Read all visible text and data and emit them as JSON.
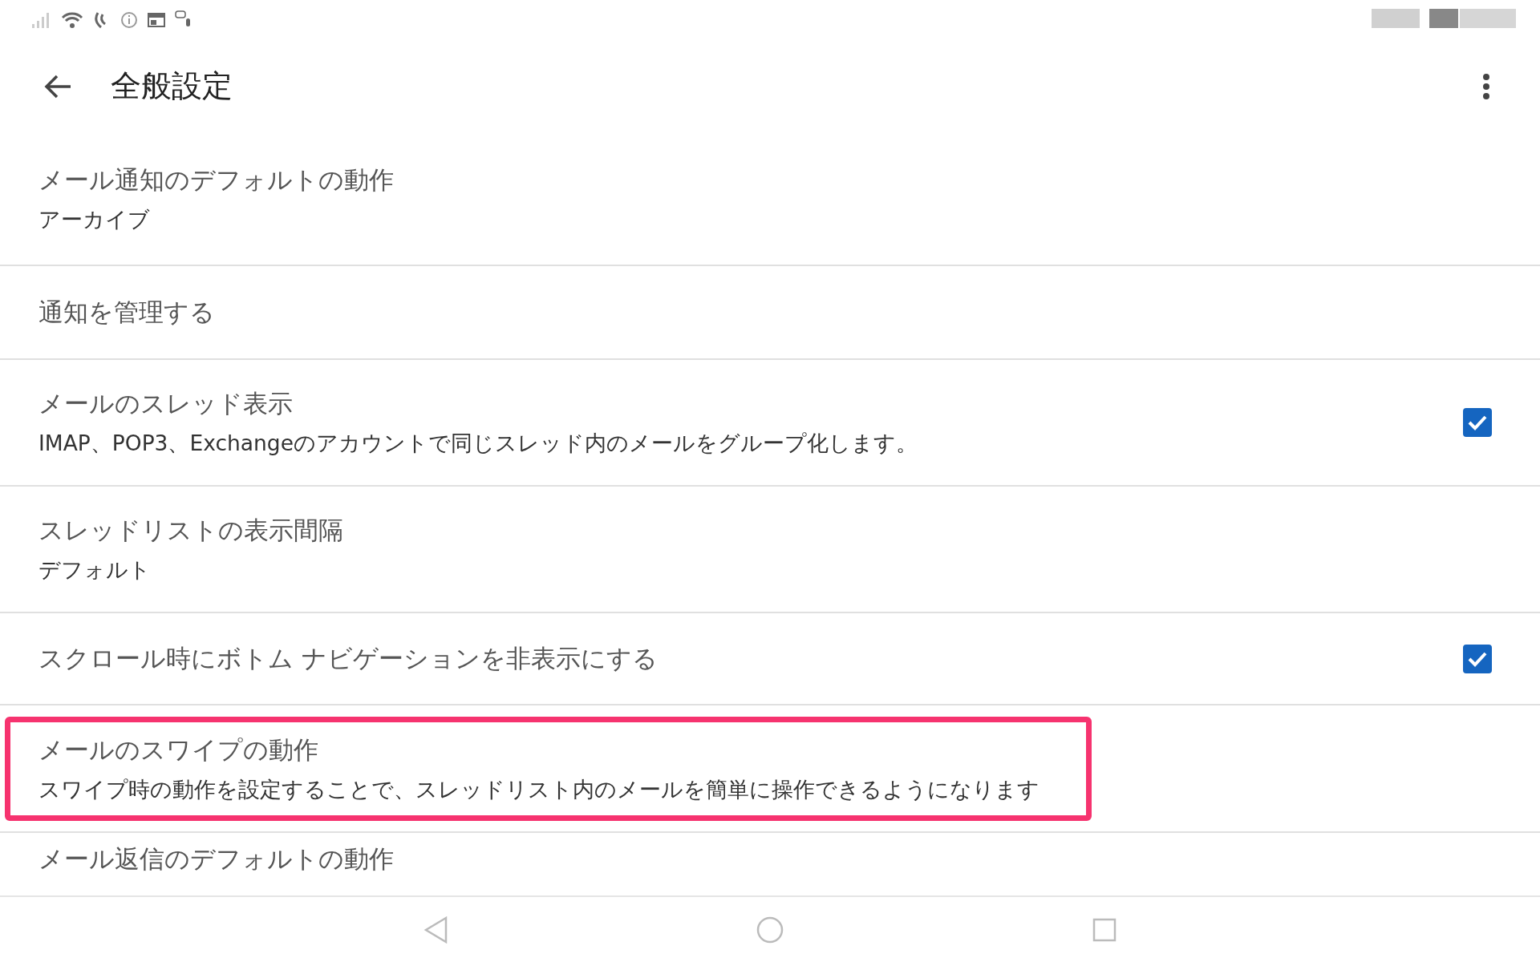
{
  "header": {
    "title": "全般設定"
  },
  "settings": [
    {
      "title": "メール通知のデフォルトの動作",
      "subtitle": "アーカイブ",
      "highlighted": false
    },
    {
      "title": "通知を管理する",
      "highlighted": false
    },
    {
      "title": "メールのスレッド表示",
      "subtitle": "IMAP、POP3、Exchangeのアカウントで同じスレッド内のメールをグループ化します。",
      "checked": true,
      "highlighted": false
    },
    {
      "title": "スレッドリストの表示間隔",
      "subtitle": "デフォルト",
      "highlighted": false
    },
    {
      "title": "スクロール時にボトム ナビゲーションを非表示にする",
      "checked": true,
      "highlighted": false
    },
    {
      "title": "メールのスワイプの動作",
      "subtitle": "スワイプ時の動作を設定することで、スレッドリスト内のメールを簡単に操作できるようになります",
      "highlighted": true
    },
    {
      "title": "メール返信のデフォルトの動作",
      "highlighted": false
    }
  ]
}
